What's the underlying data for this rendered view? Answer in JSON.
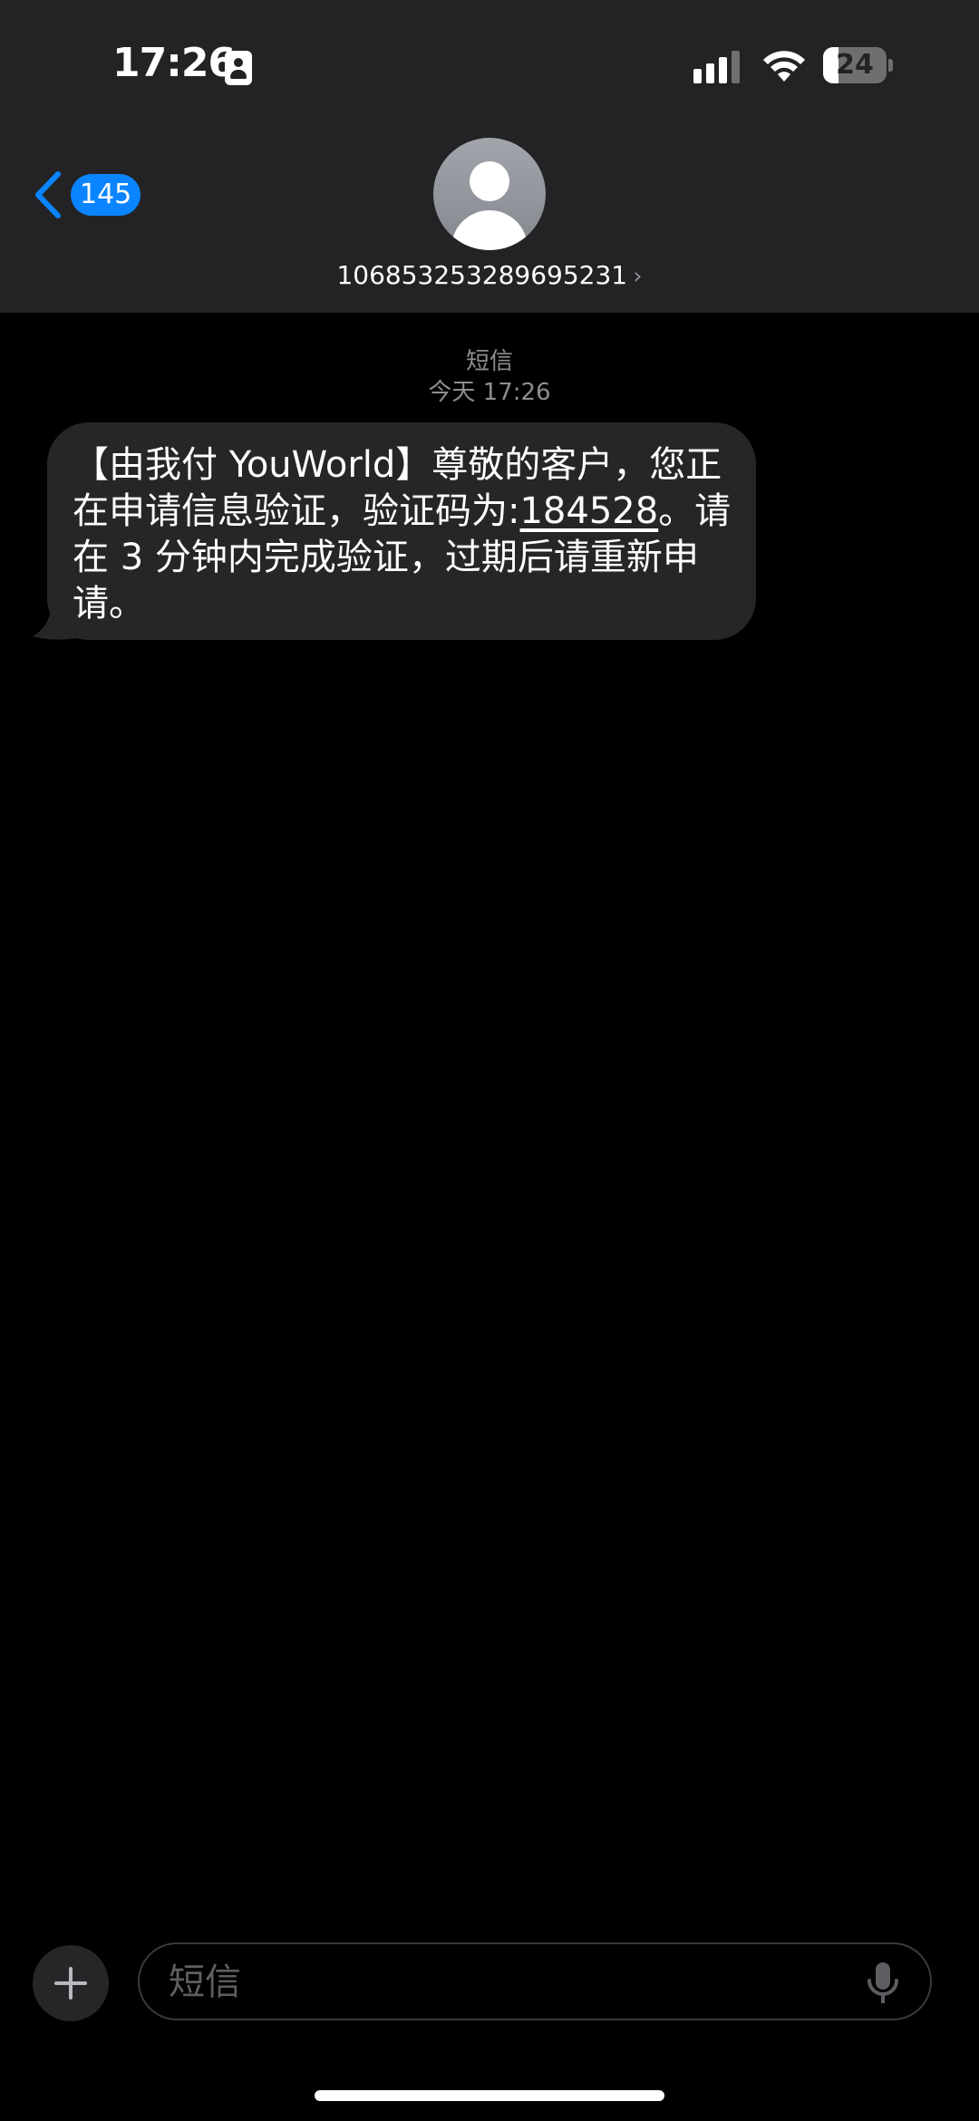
{
  "status_bar": {
    "time": "17:26",
    "battery_level": "24",
    "battery_fraction": 0.24
  },
  "header": {
    "back_badge_count": "145",
    "contact_number": "106853253289695231",
    "contact_chevron": "›"
  },
  "conversation": {
    "message_type_label": "短信",
    "timestamp": "今天 17:26",
    "messages": [
      {
        "direction": "incoming",
        "text_before_code": "【由我付 YouWorld】尊敬的客户，您正在申请信息验证，验证码为:",
        "code": "184528",
        "text_after_code": "。请在 3 分钟内完成验证，过期后请重新申请。"
      }
    ]
  },
  "composer": {
    "placeholder": "短信"
  },
  "icons": {
    "status_id": "person-card-icon",
    "signal": "cellular-signal-icon",
    "wifi": "wifi-icon",
    "battery": "battery-icon",
    "back": "chevron-left-icon",
    "avatar": "person-silhouette-icon",
    "plus": "plus-icon",
    "mic": "microphone-icon"
  },
  "colors": {
    "accent": "#0a84ff",
    "header_bg": "#232325",
    "bubble_bg": "#262628",
    "secondary_text": "#8d8d92"
  }
}
